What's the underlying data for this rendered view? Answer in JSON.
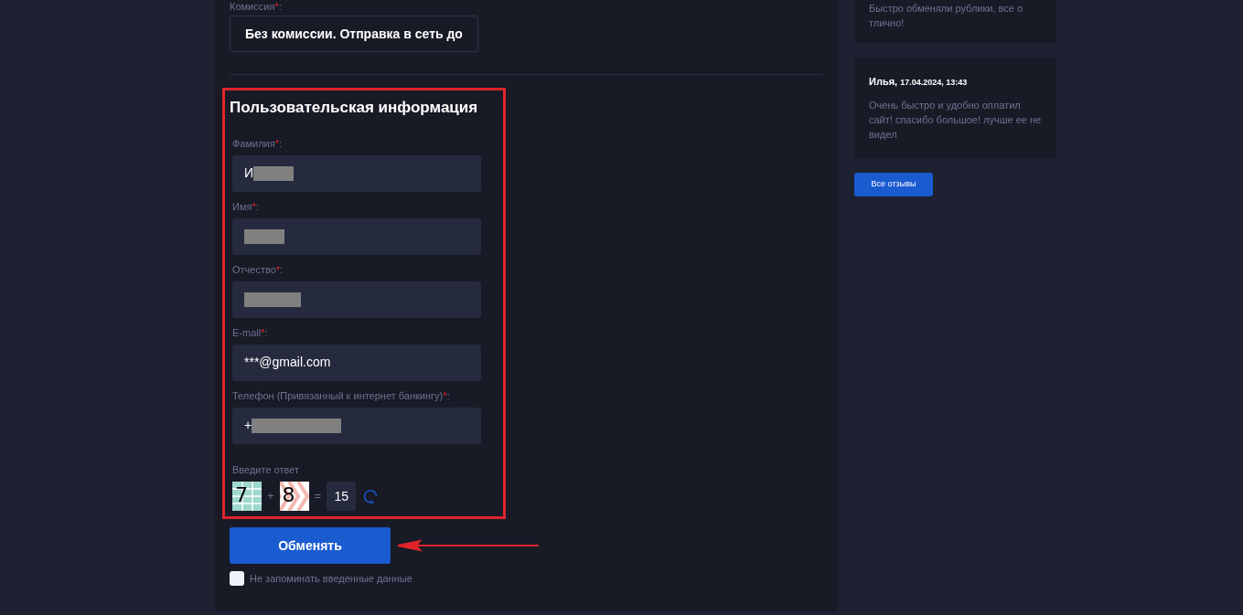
{
  "commission": {
    "label": "Комиссия",
    "required_mark": "*",
    "colon": ":",
    "value": "Без комиссии. Отправка в сеть до"
  },
  "user_info": {
    "title": "Пользовательская информация",
    "highlighted": true,
    "fields": [
      {
        "label": "Фамилия",
        "required_mark": "*",
        "colon": ":",
        "value": "И",
        "redacted": true
      },
      {
        "label": "Имя",
        "required_mark": "*",
        "colon": ":",
        "redacted": true
      },
      {
        "label": "Отчество",
        "required_mark": "*",
        "colon": ":",
        "redacted": true
      },
      {
        "label": "E-mail",
        "required_mark": "*",
        "colon": ":",
        "value": "***@gmail.com",
        "redacted": false
      },
      {
        "label": "Телефон (Привязанный к интернет банкингу)",
        "required_mark": "*",
        "colon": ":",
        "value": "+",
        "redacted": true
      }
    ],
    "captcha": {
      "label": "Введите ответ",
      "operand_1": "7",
      "operator": "+",
      "operand_2": "8",
      "equals": "=",
      "answer": "15"
    }
  },
  "submit_button": "Обменять",
  "remember": {
    "label": "Не запоминать введенные данные",
    "checked": false
  },
  "reviews": [
    {
      "text": "Быстро обменяли рублики, все о тлично!"
    },
    {
      "author": "Илья,",
      "date": "17.04.2024, 13:43",
      "text": "Очень быстро и удобно оплатил сайт! спасибо большое! лучше ее не видел"
    }
  ],
  "all_reviews_button": "Все отзывы"
}
